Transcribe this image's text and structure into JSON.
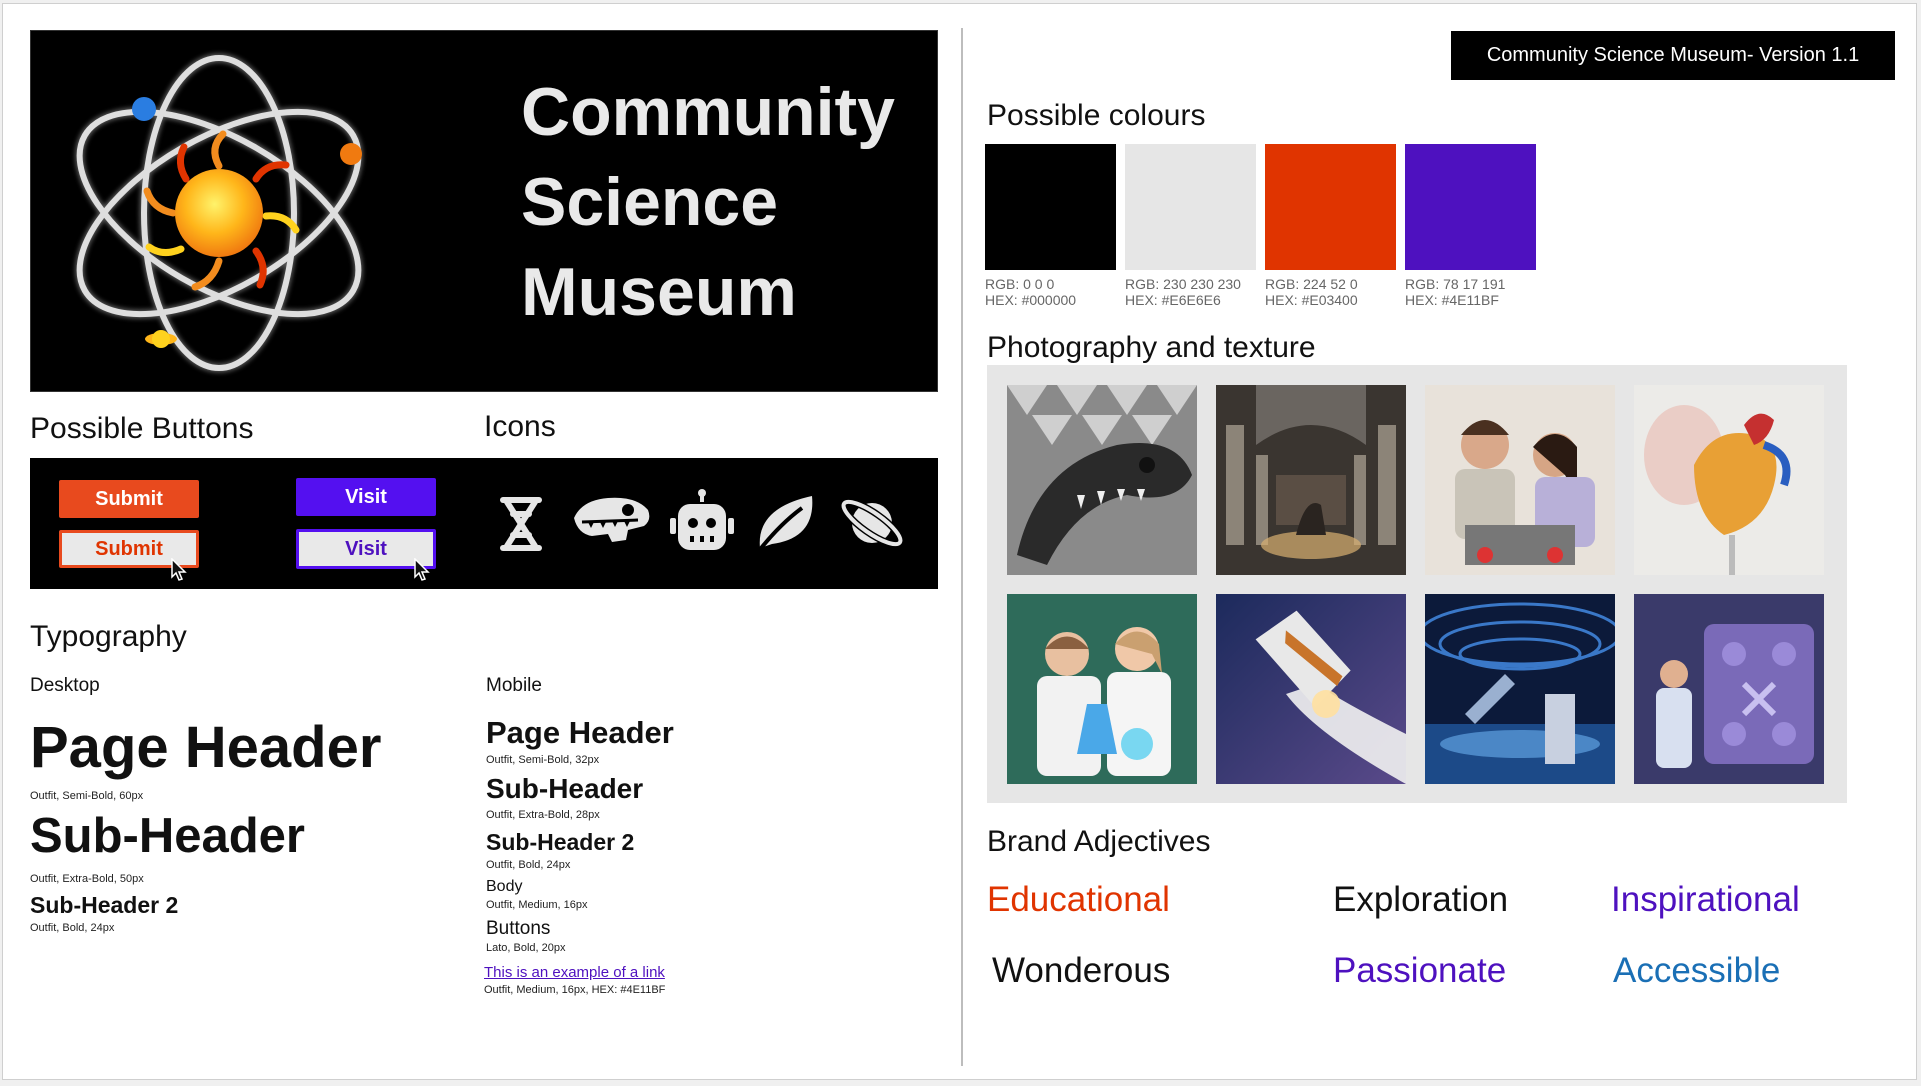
{
  "version_badge": "Community Science Museum- Version 1.1",
  "logo": {
    "title_lines": [
      "Community",
      "Science",
      "Museum"
    ]
  },
  "buttons_section": {
    "title": "Possible Buttons",
    "submit_label": "Submit",
    "visit_label": "Visit"
  },
  "icons_section": {
    "title": "Icons",
    "icons": [
      "dna-icon",
      "dinosaur-skull-icon",
      "robot-icon",
      "leaf-icon",
      "planet-icon"
    ]
  },
  "typography": {
    "title": "Typography",
    "desktop": {
      "label": "Desktop",
      "page_header": "Page Header",
      "page_header_spec": "Outfit, Semi-Bold, 60px",
      "sub_header": "Sub-Header",
      "sub_header_spec": "Outfit, Extra-Bold, 50px",
      "sub_header_2": "Sub-Header 2",
      "sub_header_2_spec": "Outfit, Bold, 24px"
    },
    "mobile": {
      "label": "Mobile",
      "page_header": "Page Header",
      "page_header_spec": "Outfit, Semi-Bold, 32px",
      "sub_header": "Sub-Header",
      "sub_header_spec": "Outfit, Extra-Bold, 28px",
      "sub_header_2": "Sub-Header 2",
      "sub_header_2_spec": "Outfit, Bold, 24px",
      "body": "Body",
      "body_spec": "Outfit, Medium, 16px",
      "buttons": "Buttons",
      "buttons_spec": "Lato, Bold, 20px",
      "link": "This is an example of a link",
      "link_spec": "Outfit, Medium, 16px, HEX: #4E11BF"
    }
  },
  "colours_section": {
    "title": "Possible colours",
    "swatches": [
      {
        "hex": "#000000",
        "rgb_label": "RGB: 0 0 0",
        "hex_label": "HEX: #000000"
      },
      {
        "hex": "#E6E6E6",
        "rgb_label": "RGB: 230 230 230",
        "hex_label": "HEX: #E6E6E6"
      },
      {
        "hex": "#E03400",
        "rgb_label": "RGB: 224 52 0",
        "hex_label": "HEX: #E03400"
      },
      {
        "hex": "#4E11BF",
        "rgb_label": "RGB: 78 17 191",
        "hex_label": "HEX: #4E11BF"
      }
    ]
  },
  "photo_section": {
    "title": "Photography and texture",
    "photos": [
      "dinosaur-skeleton-photo",
      "museum-hall-photo",
      "kids-robotics-photo",
      "heart-model-photo",
      "kids-chemistry-photo",
      "space-shuttle-photo",
      "planetarium-exhibit-photo",
      "lab-machine-photo"
    ]
  },
  "adjectives_section": {
    "title": "Brand Adjectives",
    "words": [
      {
        "text": "Educational",
        "color": "#E03400"
      },
      {
        "text": "Exploration",
        "color": "#111111"
      },
      {
        "text": "Inspirational",
        "color": "#4E11BF"
      },
      {
        "text": "Wonderous",
        "color": "#111111"
      },
      {
        "text": "Passionate",
        "color": "#4E11BF"
      },
      {
        "text": "Accessible",
        "color": "#1A6FB5"
      }
    ]
  }
}
